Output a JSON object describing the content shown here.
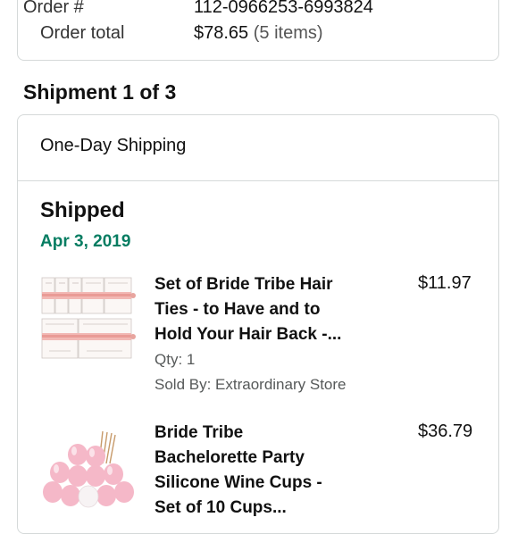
{
  "order": {
    "number_label": "Order #",
    "number_value": "112-0966253-6993824",
    "total_label": "Order total",
    "total_value": "$78.65",
    "total_items": "(5 items)"
  },
  "shipment": {
    "title": "Shipment 1 of 3",
    "method": "One-Day Shipping",
    "status": "Shipped",
    "date": "Apr 3, 2019",
    "items": [
      {
        "title_lines": [
          "Set of Bride Tribe Hair",
          "Ties - to Have and to",
          "Hold Your Hair Back -..."
        ],
        "price": "$11.97",
        "qty": "Qty: 1",
        "seller": "Sold By: Extraordinary Store",
        "image": "hair-ties-product-image"
      },
      {
        "title_lines": [
          "Bride Tribe",
          "Bachelorette Party",
          "Silicone Wine Cups -",
          "Set of 10 Cups..."
        ],
        "price": "$36.79",
        "image": "wine-cups-product-image"
      }
    ]
  },
  "colors": {
    "shipped_date": "#067d62",
    "border": "#d5d9d9"
  }
}
